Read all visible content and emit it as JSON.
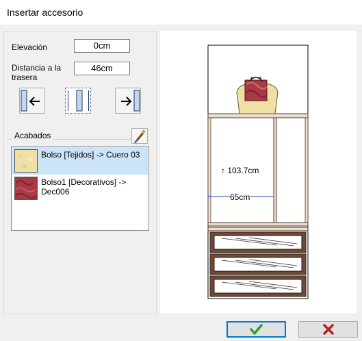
{
  "window": {
    "title": "Insertar accesorio"
  },
  "form": {
    "elevation_label": "Elevación",
    "elevation_value": "0cm",
    "distance_label": "Distancia a la trasera",
    "distance_value": "46cm"
  },
  "position_buttons": [
    {
      "name": "align-left",
      "icon": "arrow-left-icon"
    },
    {
      "name": "align-center",
      "icon": "center-icon",
      "selected": true
    },
    {
      "name": "align-right",
      "icon": "arrow-right-icon"
    }
  ],
  "finishes": {
    "label": "Acabados",
    "brush_icon": "paint-brush-icon",
    "items": [
      {
        "text": "Bolso [Tejidos] -> Cuero 03",
        "swatch_color": "#efe0a6",
        "selected": true
      },
      {
        "text": "Bolso1 [Decorativos] -> Dec006",
        "swatch_color": "#a93a45",
        "selected": false
      }
    ]
  },
  "preview": {
    "height_label": "↑ 103.7cm",
    "width_label": "65cm"
  },
  "buttons": {
    "ok_icon": "check-icon",
    "cancel_icon": "x-icon"
  },
  "colors": {
    "ok_green": "#2e9e2e",
    "cancel_red": "#b22222",
    "dimension_blue": "#1f3fb3"
  }
}
